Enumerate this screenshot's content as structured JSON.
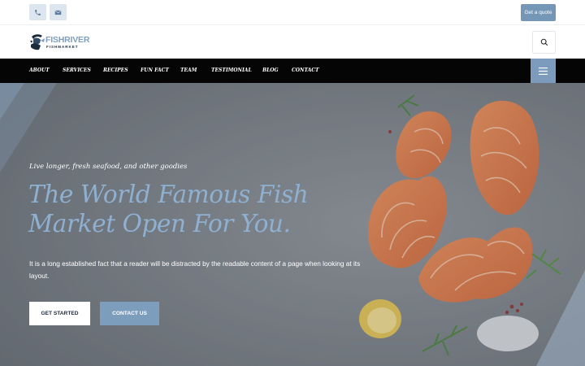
{
  "topbar": {
    "phone_icon": "phone-icon",
    "email_icon": "envelope-icon",
    "quote_label": "Get a quote"
  },
  "logo": {
    "name": "FISHRIVER",
    "sub": "FISHMARKET"
  },
  "nav": {
    "items": [
      "ABOUT",
      "SERVICES",
      "RECIPES",
      "FUN FACT",
      "TEAM",
      "TESTIMONIAL",
      "BLOG",
      "CONTACT"
    ],
    "menu_icon": "hamburger-icon",
    "search_icon": "search-icon"
  },
  "hero": {
    "tagline": "Live longer, fresh seafood, and other goodies",
    "headline": "The World Famous Fish Market Open For You.",
    "text": "It is a long established fact that a reader will be distracted by the readable content of a page when looking at its layout.",
    "primary_button": "GET STARTED",
    "secondary_button": "CONTACT US"
  },
  "colors": {
    "accent": "#7d9dbd",
    "headline": "#8fb0d1",
    "nav_bg": "#050505",
    "hero_overlay": "#6f757c"
  }
}
